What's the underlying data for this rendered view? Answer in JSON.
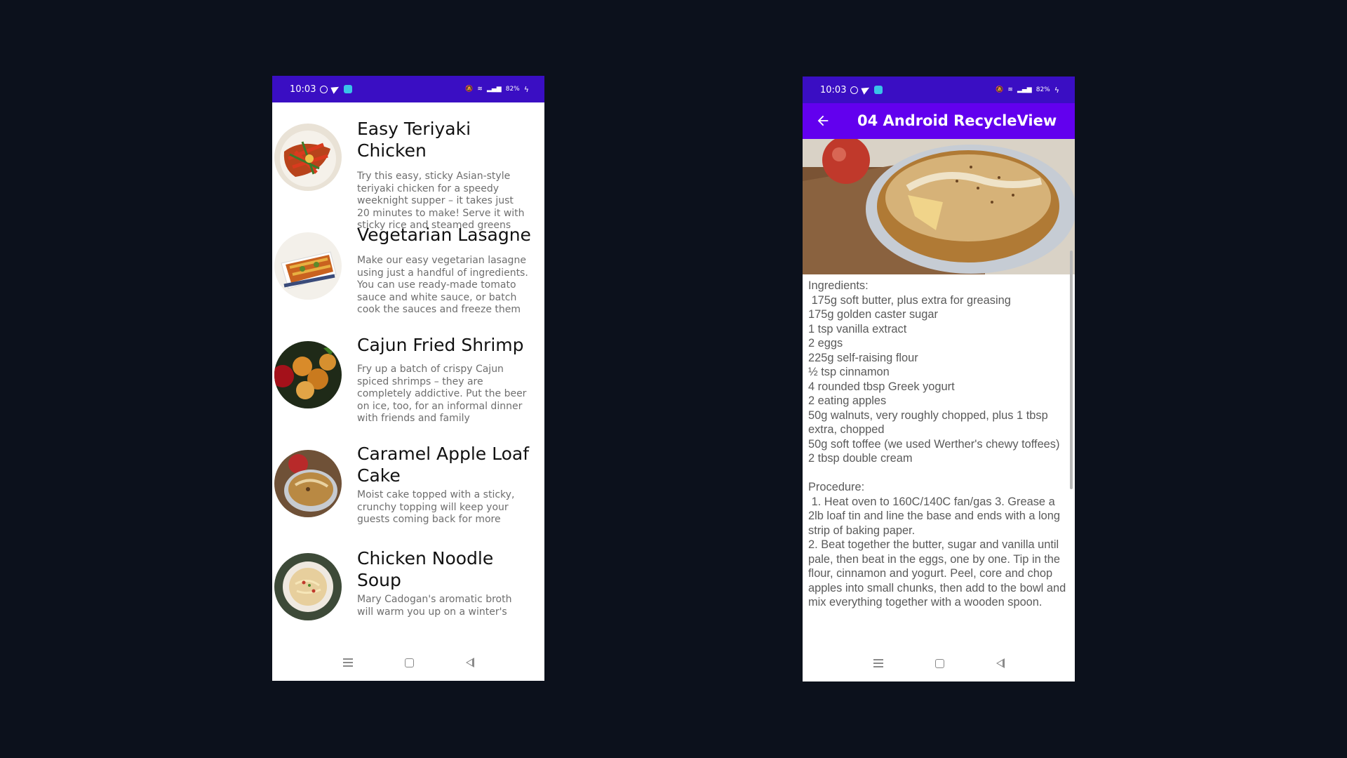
{
  "status_bar": {
    "time": "10:03",
    "battery": "82%"
  },
  "list_screen": {
    "recipes": [
      {
        "title": "Easy Teriyaki Chicken",
        "description": "Try this easy, sticky Asian-style teriyaki chicken for a speedy weeknight supper – it takes just 20 minutes to make! Serve it with sticky rice and steamed greens"
      },
      {
        "title": "Vegetarian Lasagne",
        "description": "Make our easy vegetarian lasagne using just a handful of ingredients. You can use ready-made tomato sauce and white sauce, or batch cook the sauces and freeze them"
      },
      {
        "title": "Cajun Fried Shrimp",
        "description": "Fry up a batch of crispy Cajun spiced shrimps – they are completely addictive. Put the beer on ice, too, for an informal dinner with friends and family"
      },
      {
        "title": "Caramel Apple Loaf Cake",
        "description": "Moist cake topped with a sticky, crunchy topping will keep your guests coming back for more"
      },
      {
        "title": "Chicken Noodle Soup",
        "description": "Mary Cadogan's aromatic broth will warm you up on a winter's"
      }
    ]
  },
  "detail_screen": {
    "app_title": "04 Android RecycleView",
    "text": "Ingredients:\n 175g soft butter, plus extra for greasing\n175g golden caster sugar\n1 tsp vanilla extract\n2 eggs\n225g self-raising flour\n½ tsp cinnamon\n4 rounded tbsp Greek yogurt\n2 eating apples\n50g walnuts, very roughly chopped, plus 1 tbsp extra, chopped\n50g soft toffee (we used Werther's chewy toffees)\n2 tbsp double cream\n\nProcedure:\n 1. Heat oven to 160C/140C fan/gas 3. Grease a 2lb loaf tin and line the base and ends with a long strip of baking paper.\n2. Beat together the butter, sugar and vanilla until pale, then beat in the eggs, one by one. Tip in the flour, cinnamon and yogurt. Peel, core and chop apples into small chunks, then add to the bowl and mix everything together with a wooden spoon."
  },
  "colors": {
    "status_bar": "#3a0ec3",
    "app_bar": "#6200ee",
    "background": "#0c111c"
  },
  "icons": [
    "whatsapp-icon",
    "telegram-icon",
    "app-icon",
    "wifi-icon",
    "signal-icon",
    "battery-icon",
    "back-arrow-icon",
    "recents-icon",
    "home-icon",
    "back-icon"
  ]
}
